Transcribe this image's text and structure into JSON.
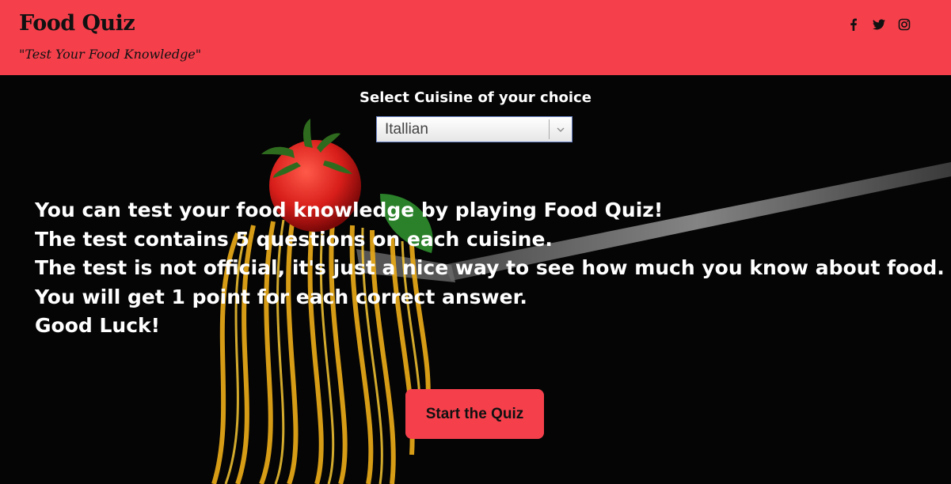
{
  "header": {
    "brand": "Food Quiz",
    "tagline": "\"Test Your Food Knowledge\"",
    "social": [
      {
        "icon": "facebook-icon"
      },
      {
        "icon": "twitter-icon"
      },
      {
        "icon": "instagram-icon"
      }
    ]
  },
  "cuisine": {
    "label": "Select Cuisine of your choice",
    "selected": "Itallian"
  },
  "intro": {
    "lines": [
      "You can test your food knowledge by playing Food Quiz!",
      "The test contains 5 questions on each cuisine.",
      "The test is not official, it's just a nice way to see how much you know about food.",
      "You will get 1 point for each correct answer.",
      "Good Luck!"
    ]
  },
  "start_button": {
    "label": "Start the Quiz"
  },
  "colors": {
    "accent": "#f5404c",
    "background": "#050505"
  }
}
